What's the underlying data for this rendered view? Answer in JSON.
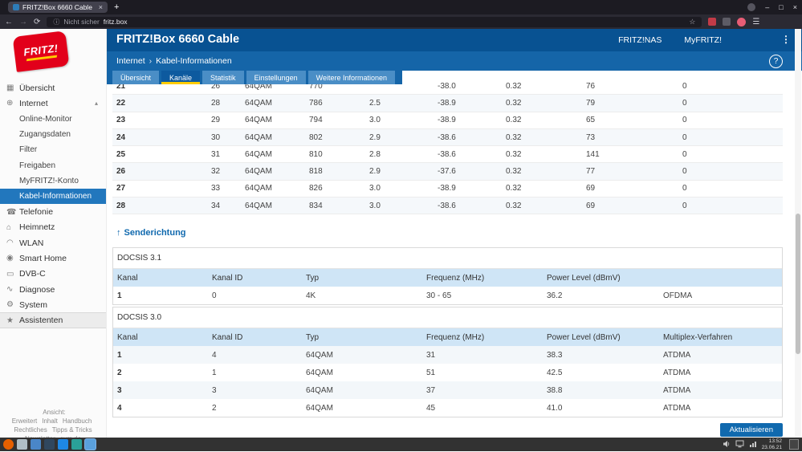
{
  "browser": {
    "tab_title": "FRITZ!Box 6660 Cable",
    "tab_close": "×",
    "new_tab": "+",
    "window_controls": {
      "minimize": "–",
      "maximize": "□",
      "close": "×"
    },
    "toolbar": {
      "back": "←",
      "forward": "→",
      "reload": "⟳",
      "info_icon": "ⓘ",
      "security_label": "Nicht sicher",
      "url": "fritz.box",
      "bookmark": "☆",
      "menu": "☰"
    }
  },
  "page": {
    "header": {
      "title": "FRITZ!Box 6660 Cable",
      "nas_link": "FRITZ!NAS",
      "myfritz_link": "MyFRITZ!",
      "menu_icon": "⋮"
    },
    "breadcrumb": {
      "section": "Internet",
      "separator": "›",
      "page": "Kabel-Informationen",
      "help": "?"
    },
    "tabs": [
      {
        "label": "Übersicht"
      },
      {
        "label": "Kanäle",
        "active": true
      },
      {
        "label": "Statistik"
      },
      {
        "label": "Einstellungen"
      },
      {
        "label": "Weitere Informationen"
      }
    ],
    "refresh_button": "Aktualisieren"
  },
  "logo": {
    "text": "FRITZ!"
  },
  "sidebar": {
    "items": [
      {
        "label": "Übersicht",
        "icon": "overview-icon"
      },
      {
        "label": "Internet",
        "icon": "globe-icon",
        "expanded": true,
        "children": [
          {
            "label": "Online-Monitor"
          },
          {
            "label": "Zugangsdaten"
          },
          {
            "label": "Filter"
          },
          {
            "label": "Freigaben"
          },
          {
            "label": "MyFRITZ!-Konto"
          },
          {
            "label": "Kabel-Informationen",
            "selected": true
          }
        ]
      },
      {
        "label": "Telefonie",
        "icon": "phone-icon"
      },
      {
        "label": "Heimnetz",
        "icon": "home-network-icon"
      },
      {
        "label": "WLAN",
        "icon": "wifi-icon"
      },
      {
        "label": "Smart Home",
        "icon": "smart-home-icon"
      },
      {
        "label": "DVB-C",
        "icon": "tv-icon"
      },
      {
        "label": "Diagnose",
        "icon": "diagnose-icon"
      },
      {
        "label": "System",
        "icon": "gear-icon"
      },
      {
        "label": "Assistenten",
        "icon": "wizard-icon",
        "style": "assist"
      }
    ],
    "footer_lines": [
      [
        "Ansicht: Erweitert",
        "Inhalt",
        "Handbuch"
      ],
      [
        "Rechtliches",
        "Tipps & Tricks"
      ],
      [
        "Newsletter",
        "avm.de"
      ]
    ]
  },
  "receive_table": {
    "rows": [
      [
        "21",
        "26",
        "64QAM",
        "770",
        "",
        "-38.0",
        "0.32",
        "76",
        "0"
      ],
      [
        "22",
        "28",
        "64QAM",
        "786",
        "2.5",
        "-38.9",
        "0.32",
        "79",
        "0"
      ],
      [
        "23",
        "29",
        "64QAM",
        "794",
        "3.0",
        "-38.9",
        "0.32",
        "65",
        "0"
      ],
      [
        "24",
        "30",
        "64QAM",
        "802",
        "2.9",
        "-38.6",
        "0.32",
        "73",
        "0"
      ],
      [
        "25",
        "31",
        "64QAM",
        "810",
        "2.8",
        "-38.6",
        "0.32",
        "141",
        "0"
      ],
      [
        "26",
        "32",
        "64QAM",
        "818",
        "2.9",
        "-37.6",
        "0.32",
        "77",
        "0"
      ],
      [
        "27",
        "33",
        "64QAM",
        "826",
        "3.0",
        "-38.9",
        "0.32",
        "69",
        "0"
      ],
      [
        "28",
        "34",
        "64QAM",
        "834",
        "3.0",
        "-38.6",
        "0.32",
        "69",
        "0"
      ]
    ]
  },
  "send_section": {
    "title_arrow": "↑",
    "title": "Senderichtung",
    "docsis31": {
      "label": "DOCSIS 3.1",
      "striped": false,
      "headers": [
        "Kanal",
        "Kanal ID",
        "Typ",
        "Frequenz (MHz)",
        "Power Level (dBmV)",
        ""
      ],
      "rows": [
        [
          "1",
          "0",
          "4K",
          "30 - 65",
          "36.2",
          "OFDMA"
        ]
      ]
    },
    "docsis30": {
      "label": "DOCSIS 3.0",
      "striped": true,
      "headers": [
        "Kanal",
        "Kanal ID",
        "Typ",
        "Frequenz (MHz)",
        "Power Level (dBmV)",
        "Multiplex-Verfahren"
      ],
      "rows": [
        [
          "1",
          "4",
          "64QAM",
          "31",
          "38.3",
          "ATDMA"
        ],
        [
          "2",
          "1",
          "64QAM",
          "51",
          "42.5",
          "ATDMA"
        ],
        [
          "3",
          "3",
          "64QAM",
          "37",
          "38.8",
          "ATDMA"
        ],
        [
          "4",
          "2",
          "64QAM",
          "45",
          "41.0",
          "ATDMA"
        ]
      ]
    }
  },
  "taskbar": {
    "apps": [
      {
        "icon": "firefox-icon",
        "color": "#e66000",
        "round": true
      },
      {
        "icon": "app-icon",
        "color": "#b0bec5"
      },
      {
        "icon": "app-icon",
        "color": "#4a86c8"
      },
      {
        "icon": "app-icon",
        "color": "#30475e"
      },
      {
        "icon": "app-icon",
        "color": "#1e88e5"
      },
      {
        "icon": "app-icon",
        "color": "#2aa198"
      },
      {
        "icon": "browser-window-icon",
        "color": "#5aa0dc",
        "active": true
      }
    ],
    "clock_time": "13:52",
    "clock_date": "23.06.21"
  },
  "colors": {
    "brand_red": "#e2001a",
    "brand_yellow": "#ffcc00",
    "header_blue": "#085292",
    "bar_blue": "#1565a8",
    "tab_blue": "#4a8ec6",
    "tab_active_blue": "#0d5a9f",
    "selected_blue": "#2277bd",
    "table_header_blue": "#cfe5f6",
    "button_blue": "#1069ae"
  },
  "icons": {
    "overview-icon": "▦",
    "globe-icon": "⊕",
    "phone-icon": "☎",
    "home-network-icon": "⌂",
    "wifi-icon": "◠",
    "smart-home-icon": "◉",
    "tv-icon": "▭",
    "diagnose-icon": "∿",
    "gear-icon": "⚙",
    "wizard-icon": "★",
    "chevron-up-icon": "▴"
  }
}
